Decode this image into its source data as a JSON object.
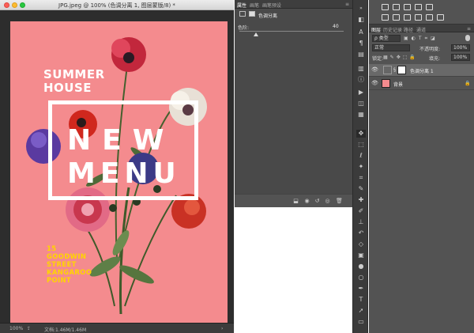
{
  "document": {
    "title": "JPG.jpeg @ 100% (色调分离 1, 图层蒙版/8) *",
    "zoom": "100%",
    "doc_info": "文档:1.46M/1.46M",
    "poster": {
      "line1": "SUMMER",
      "line2": "HOUSE",
      "word1": "NEW",
      "word2": "MENU",
      "address": [
        "15",
        "GOODWIN",
        "STREET",
        "KANGAROO",
        "POINT"
      ]
    }
  },
  "properties": {
    "tabs": [
      "属性",
      "画笔",
      "画笔预设"
    ],
    "header_label": "色调分离",
    "levels_label": "色阶:",
    "levels_value": "40",
    "levels_fraction": 0.16
  },
  "layers": {
    "tabs": [
      "图层",
      "历史记录",
      "路径",
      "通道"
    ],
    "kind_filter": "ρ 类型",
    "blend_mode": "正常",
    "opacity_label": "不透明度:",
    "opacity_value": "100%",
    "lock_label": "锁定:",
    "fill_label": "填充:",
    "fill_value": "100%",
    "items": [
      {
        "name": "色调分离 1",
        "selected": true
      },
      {
        "name": "背景",
        "selected": false
      }
    ]
  }
}
